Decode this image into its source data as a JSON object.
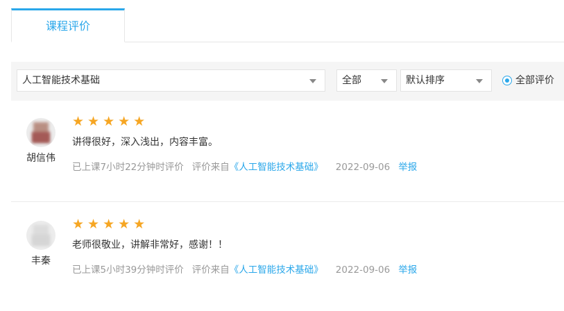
{
  "tabs": [
    {
      "label": "课程评价"
    }
  ],
  "filters": {
    "course_select": "人工智能技术基础",
    "type_select": "全部",
    "sort_select": "默认排序",
    "radio_label": "全部评价"
  },
  "reviews": [
    {
      "username": "胡信伟",
      "stars": "★★★★★",
      "rating": 5,
      "content": "讲得很好，深入浅出，内容丰富。",
      "attended": "已上课7小时22分钟时评价",
      "source_prefix": "评价来自",
      "course": "《人工智能技术基础》",
      "date": "2022-09-06",
      "report": "举报"
    },
    {
      "username": "丰秦",
      "stars": "★★★★★",
      "rating": 5,
      "content": "老师很敬业，讲解非常好，感谢！！",
      "attended": "已上课5小时39分钟时评价",
      "source_prefix": "评价来自",
      "course": "《人工智能技术基础》",
      "date": "2022-09-06",
      "report": "举报"
    }
  ],
  "colors": {
    "accent": "#2aa7ea",
    "star": "#f6a623"
  }
}
